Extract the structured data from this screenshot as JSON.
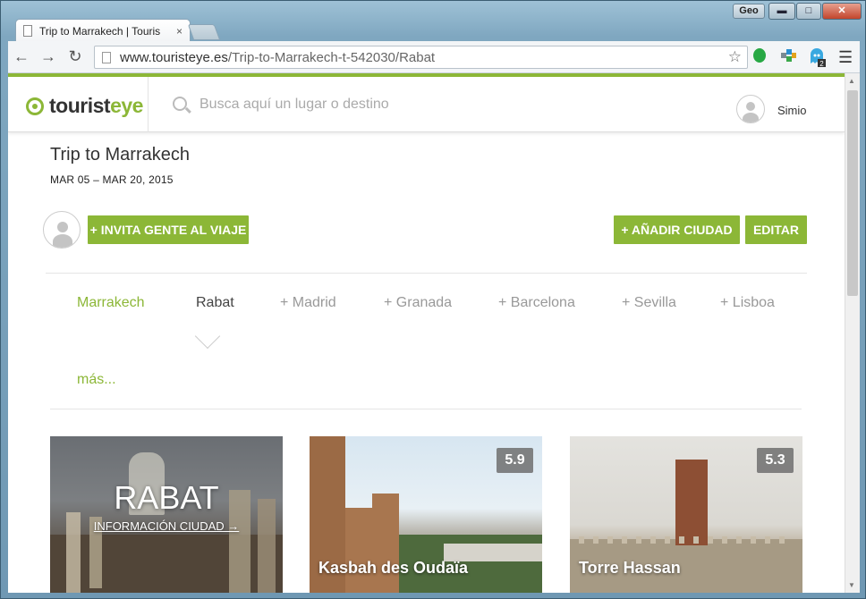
{
  "browser": {
    "tab_title": "Trip to Marrakech | Touris",
    "tab_close": "×",
    "profile": "Geo",
    "url_host": "www.touristeye.es",
    "url_path": "/Trip-to-Marrakech-t-542030/Rabat",
    "window_controls": {
      "minimize": "▬",
      "maximize": "□",
      "close": "✕"
    },
    "nav": {
      "back": "←",
      "forward": "→",
      "reload": "↻"
    },
    "extension_badge": "2"
  },
  "site": {
    "logo_left": "tourist",
    "logo_right": "eye",
    "search_placeholder": "Busca aquí un lugar o destino",
    "username": "Simio"
  },
  "trip": {
    "title": "Trip to Marrakech",
    "dates": "MAR 05 – MAR 20, 2015",
    "invite_label": "+ INVITA GENTE AL VIAJE",
    "add_city_label": "+ AÑADIR CIUDAD",
    "edit_label": "EDITAR"
  },
  "cities": [
    "Marrakech",
    "Rabat",
    "+ Madrid",
    "+ Granada",
    "+ Barcelona",
    "+ Sevilla",
    "+ Lisboa"
  ],
  "more_label": "más...",
  "cards": {
    "city": {
      "name": "RABAT",
      "info_link": "INFORMACIÓN CIUDAD →"
    },
    "places": [
      {
        "title": "Kasbah des Oudaïa",
        "score": "5.9"
      },
      {
        "title": "Torre Hassan",
        "score": "5.3"
      }
    ]
  },
  "colors": {
    "accent": "#8cb737"
  }
}
